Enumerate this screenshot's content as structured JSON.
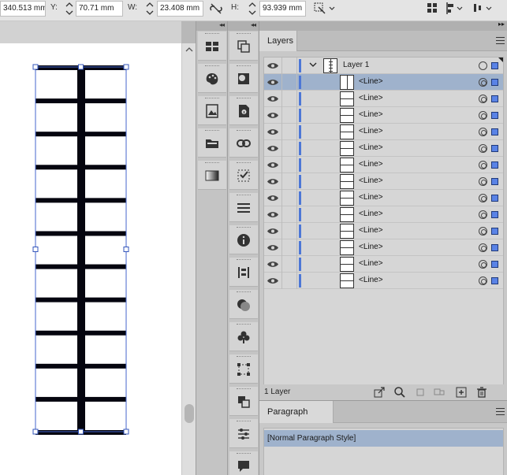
{
  "control_bar": {
    "x_value": "340.513 mm",
    "y_label": "Y:",
    "y_value": "70.71 mm",
    "w_label": "W:",
    "w_value": "23.408 mm",
    "h_label": "H:",
    "h_value": "93.939 mm"
  },
  "layers": {
    "tab": "Layers",
    "parent": "Layer 1",
    "rows": [
      "<Line>",
      "<Line>",
      "<Line>",
      "<Line>",
      "<Line>",
      "<Line>",
      "<Line>",
      "<Line>",
      "<Line>",
      "<Line>",
      "<Line>",
      "<Line>",
      "<Line>"
    ],
    "selected_row_index": 0,
    "footer_count": "1 Layer",
    "layer_color": "#4d77d6"
  },
  "paragraph_styles": {
    "tab": "Paragraph Styles",
    "items": [
      "[Normal Paragraph Style]"
    ]
  },
  "dock": {
    "col1_icons": [
      "swatches-icon",
      "color-palette-icon",
      "image-icon",
      "folder-icon",
      "gradient-icon"
    ],
    "col2_icons": [
      "pages-icon",
      "color-theme-icon",
      "info-doc-icon",
      "links-icon",
      "effects-icon",
      "stroke-icon",
      "info-icon",
      "align-icon",
      "pathfinder-icon",
      "club-icon",
      "transform-icon",
      "arrange-icon",
      "properties-icon",
      "comment-icon"
    ]
  }
}
